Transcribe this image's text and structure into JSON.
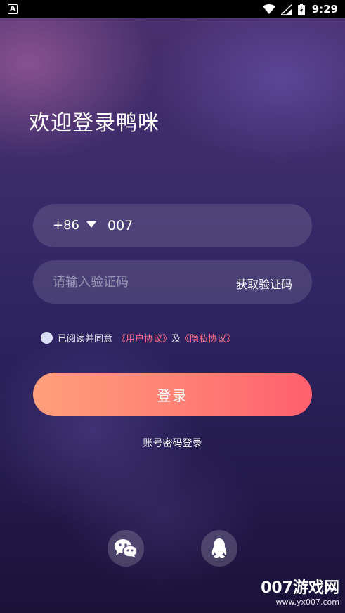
{
  "status_bar": {
    "time": "9:29",
    "left_icon": "A",
    "icons": [
      "wifi-icon",
      "signal-icon",
      "battery-icon"
    ]
  },
  "title": "欢迎登录鸭咪",
  "phone": {
    "country_code": "+86",
    "value": "007"
  },
  "verification": {
    "placeholder": "请输入验证码",
    "get_code_label": "获取验证码"
  },
  "agreement": {
    "prefix": "已阅读并同意",
    "user_agreement": "《用户协议》",
    "conjunction": "及",
    "privacy_policy": "《隐私协议》"
  },
  "login_button_label": "登录",
  "account_login_label": "账号密码登录",
  "social_icons": [
    "wechat-icon",
    "qq-icon"
  ],
  "watermark": {
    "brand": "007游戏网",
    "url": "www.yx007.com"
  },
  "colors": {
    "link": "#ff6f7f",
    "button_start": "#ff9f7c",
    "button_end": "#ff5f6e"
  }
}
